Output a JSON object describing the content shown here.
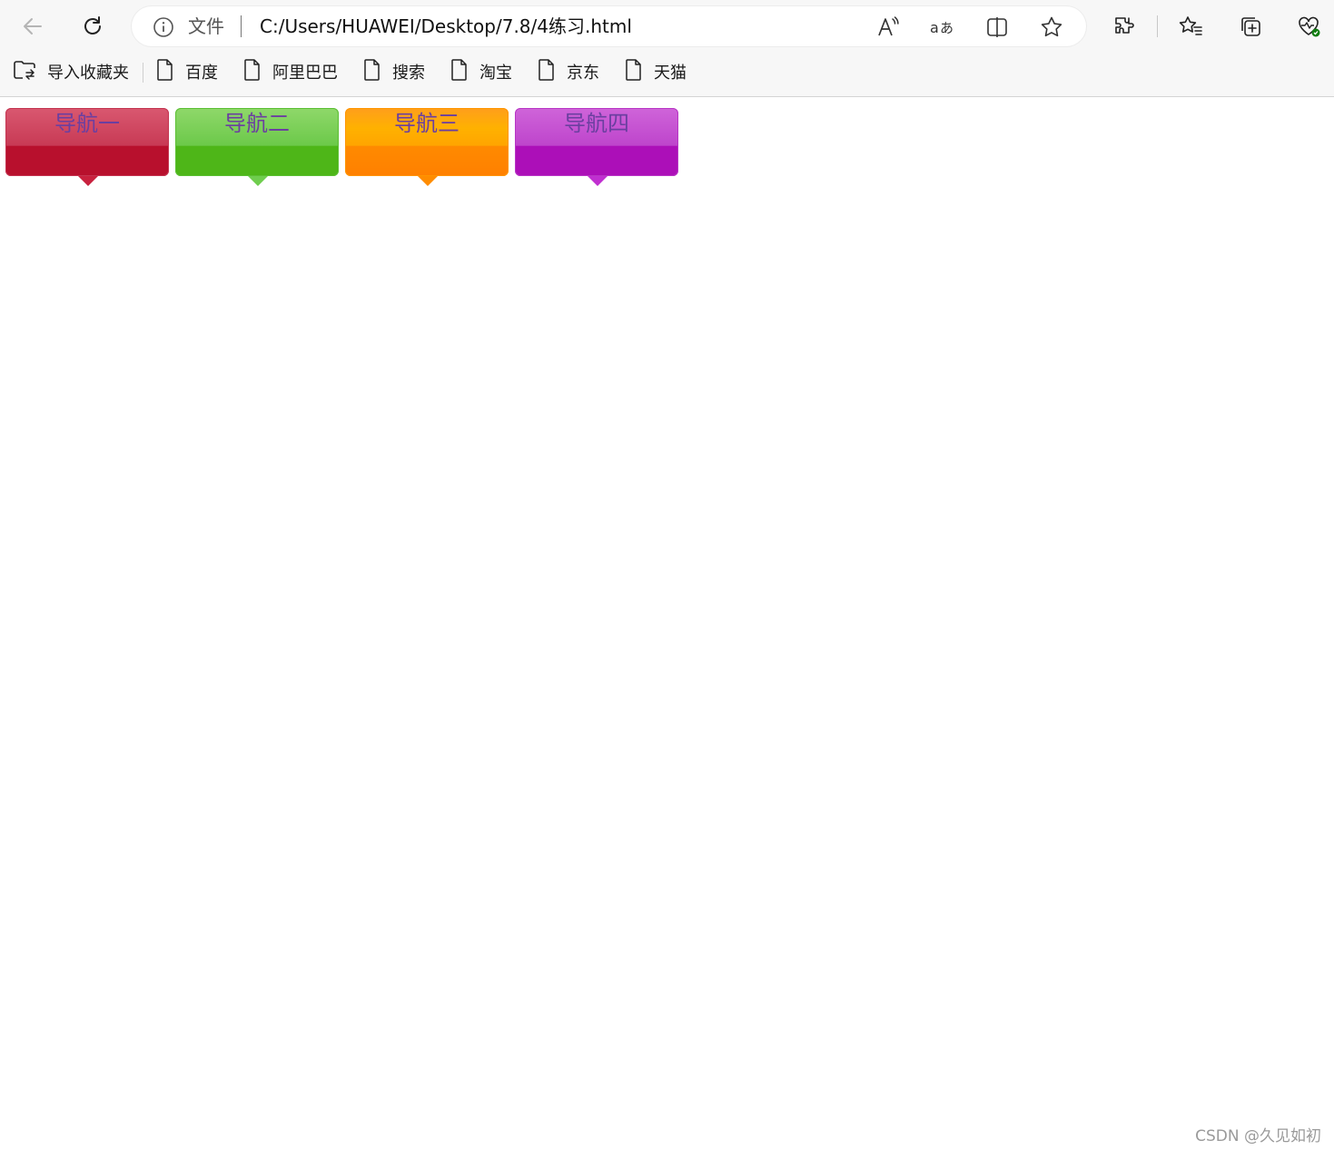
{
  "browser": {
    "address": {
      "security_label": "文件",
      "url": "C:/Users/HUAWEI/Desktop/7.8/4练习.html"
    },
    "bookmarks_bar": {
      "import_label": "导入收藏夹",
      "items": [
        {
          "label": "百度",
          "icon": "page-icon"
        },
        {
          "label": "阿里巴巴",
          "icon": "page-icon"
        },
        {
          "label": "搜索",
          "icon": "page-icon"
        },
        {
          "label": "淘宝",
          "icon": "page-icon"
        },
        {
          "label": "京东",
          "icon": "page-icon"
        },
        {
          "label": "天猫",
          "icon": "page-icon"
        }
      ]
    },
    "toolbar_icons": [
      "back-arrow-icon",
      "refresh-icon",
      "read-aloud-icon",
      "translate-icon",
      "split-screen-icon",
      "favorite-star-icon",
      "extensions-icon",
      "favorites-list-icon",
      "collections-icon",
      "browser-essentials-icon"
    ]
  },
  "page": {
    "nav_items": [
      {
        "label": "导航一",
        "color": "#b8102d"
      },
      {
        "label": "导航二",
        "color": "#4eb618"
      },
      {
        "label": "导航三",
        "color": "#ff8000"
      },
      {
        "label": "导航四",
        "color": "#ac0fb8"
      }
    ],
    "label_color": "#6b3fa0"
  },
  "watermark": "CSDN @久见如初"
}
